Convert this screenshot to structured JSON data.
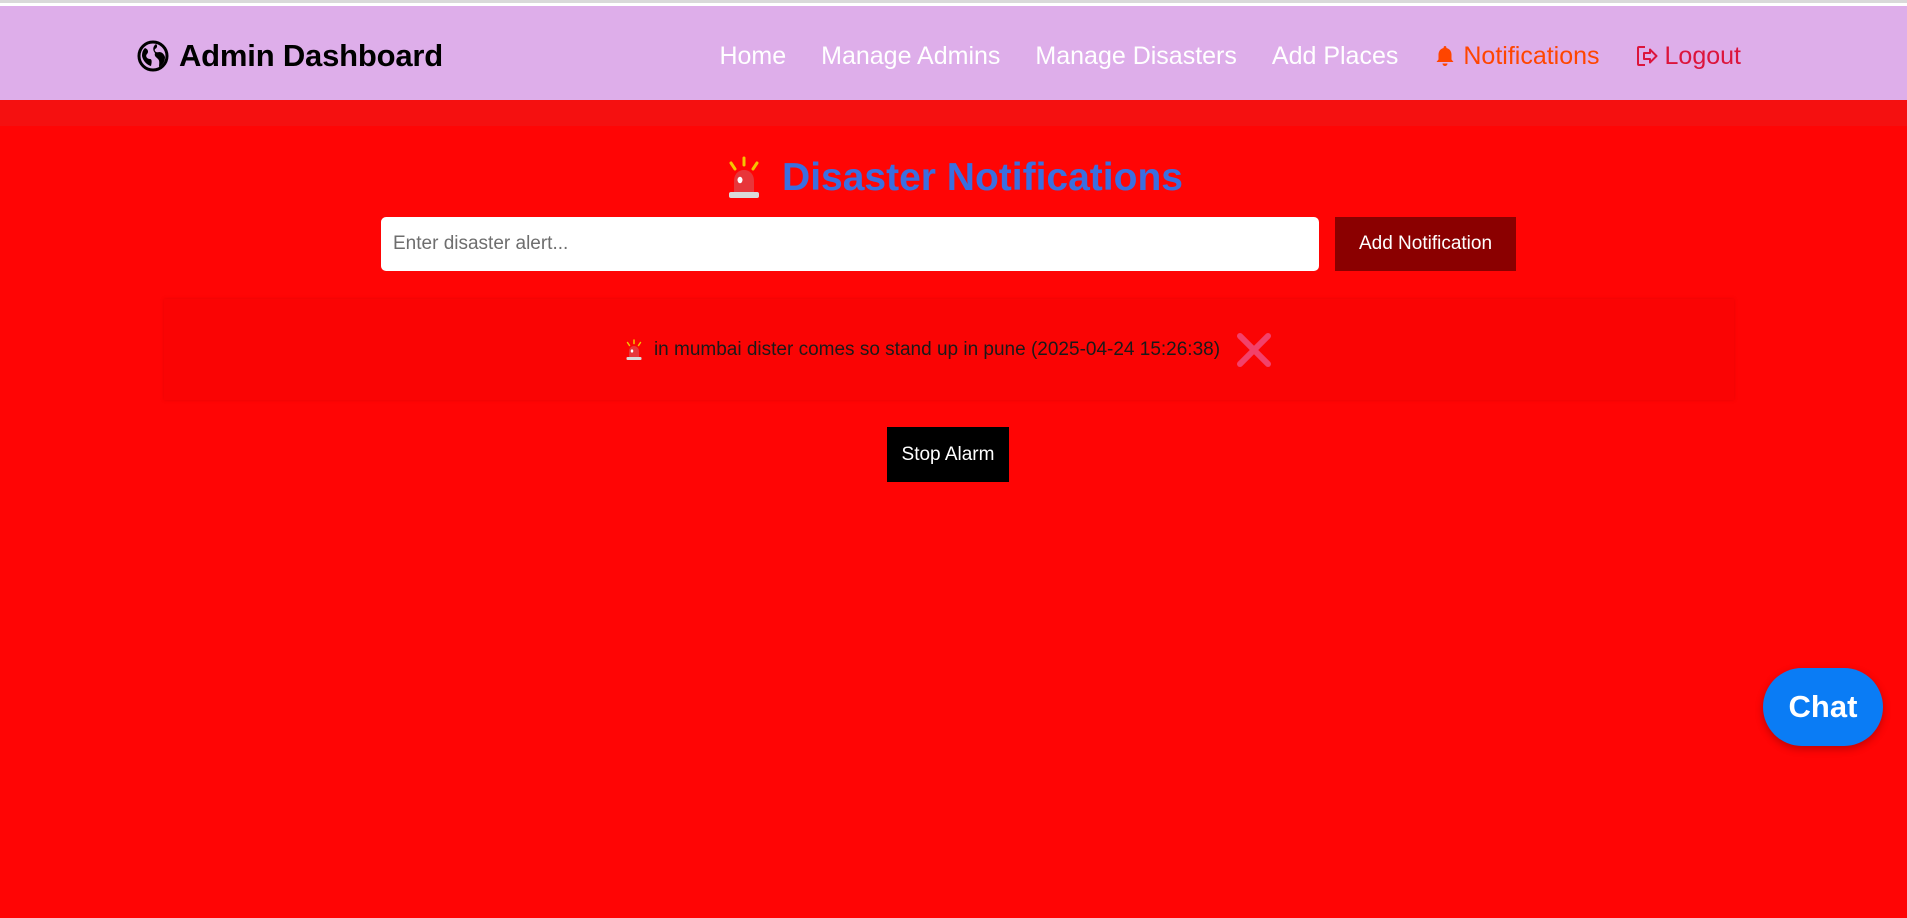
{
  "navbar": {
    "brand_icon": "globe-icon",
    "brand_title": "Admin Dashboard",
    "links": [
      {
        "label": "Home"
      },
      {
        "label": "Manage Admins"
      },
      {
        "label": "Manage Disasters"
      },
      {
        "label": "Add Places"
      },
      {
        "label": "Notifications",
        "icon": "bell-icon",
        "color": "#ff4500"
      },
      {
        "label": "Logout",
        "icon": "logout-icon",
        "color": "#dc143c"
      }
    ],
    "background": "#deaeea"
  },
  "main": {
    "background": "#ff0505",
    "heading_icon": "siren-icon",
    "heading": "Disaster Notifications",
    "heading_color": "#3a6fe0",
    "input": {
      "placeholder": "Enter disaster alert...",
      "value": ""
    },
    "add_button": "Add Notification",
    "notifications": [
      {
        "icon": "siren-icon",
        "text": "in mumbai dister comes so stand up in pune (2025-04-24 15:26:38)",
        "delete_icon": "close-icon"
      }
    ],
    "stop_button": "Stop Alarm"
  },
  "chat": {
    "label": "Chat",
    "color": "#0a7cf5"
  }
}
